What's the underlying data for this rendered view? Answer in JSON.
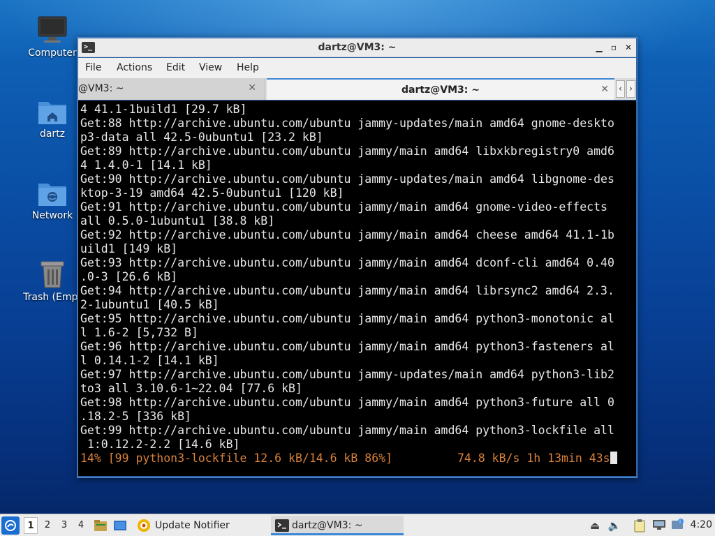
{
  "desktop": {
    "icons": [
      {
        "label": "Computer"
      },
      {
        "label": "dartz"
      },
      {
        "label": "Network"
      },
      {
        "label": "Trash (Empt"
      }
    ]
  },
  "window": {
    "title": "dartz@VM3: ~",
    "controls": {
      "minimize": "▁",
      "maximize": "▫",
      "close": "✕"
    },
    "menu": [
      "File",
      "Actions",
      "Edit",
      "View",
      "Help"
    ],
    "tabs": [
      {
        "label": "@VM3: ~",
        "active": false
      },
      {
        "label": "dartz@VM3: ~",
        "active": true
      }
    ],
    "tab_nav": {
      "prev": "‹",
      "next": "›"
    }
  },
  "terminal": {
    "lines": [
      "4 41.1-1build1 [29.7 kB]",
      "Get:88 http://archive.ubuntu.com/ubuntu jammy-updates/main amd64 gnome-deskto",
      "p3-data all 42.5-0ubuntu1 [23.2 kB]",
      "Get:89 http://archive.ubuntu.com/ubuntu jammy/main amd64 libxkbregistry0 amd6",
      "4 1.4.0-1 [14.1 kB]",
      "Get:90 http://archive.ubuntu.com/ubuntu jammy-updates/main amd64 libgnome-des",
      "ktop-3-19 amd64 42.5-0ubuntu1 [120 kB]",
      "Get:91 http://archive.ubuntu.com/ubuntu jammy/main amd64 gnome-video-effects",
      "all 0.5.0-1ubuntu1 [38.8 kB]",
      "Get:92 http://archive.ubuntu.com/ubuntu jammy/main amd64 cheese amd64 41.1-1b",
      "uild1 [149 kB]",
      "Get:93 http://archive.ubuntu.com/ubuntu jammy/main amd64 dconf-cli amd64 0.40",
      ".0-3 [26.6 kB]",
      "Get:94 http://archive.ubuntu.com/ubuntu jammy/main amd64 librsync2 amd64 2.3.",
      "2-1ubuntu1 [40.5 kB]",
      "Get:95 http://archive.ubuntu.com/ubuntu jammy/main amd64 python3-monotonic al",
      "l 1.6-2 [5,732 B]",
      "Get:96 http://archive.ubuntu.com/ubuntu jammy/main amd64 python3-fasteners al",
      "l 0.14.1-2 [14.1 kB]",
      "Get:97 http://archive.ubuntu.com/ubuntu jammy-updates/main amd64 python3-lib2",
      "to3 all 3.10.6-1~22.04 [77.6 kB]",
      "Get:98 http://archive.ubuntu.com/ubuntu jammy/main amd64 python3-future all 0",
      ".18.2-5 [336 kB]",
      "Get:99 http://archive.ubuntu.com/ubuntu jammy/main amd64 python3-lockfile all",
      " 1:0.12.2-2.2 [14.6 kB]"
    ],
    "progress_left": "14% [99 python3-lockfile 12.6 kB/14.6 kB 86%]",
    "progress_right": "74.8 kB/s 1h 13min 43s",
    "colors": {
      "text": "#e6e6e6",
      "progress": "#d9823b",
      "background": "#000000"
    }
  },
  "taskbar": {
    "workspaces": [
      "1",
      "2",
      "3",
      "4"
    ],
    "active_workspace": "1",
    "tasks": [
      {
        "label": "Update Notifier",
        "icon": "update-notifier-icon"
      },
      {
        "label": "dartz@VM3: ~",
        "icon": "terminal-icon",
        "active": true
      }
    ],
    "tray_icons": [
      "eject-icon",
      "volume-icon",
      "clipboard-icon",
      "network-icon",
      "notification-icon"
    ],
    "clock": "4:20",
    "accent": "#3d87d6"
  }
}
